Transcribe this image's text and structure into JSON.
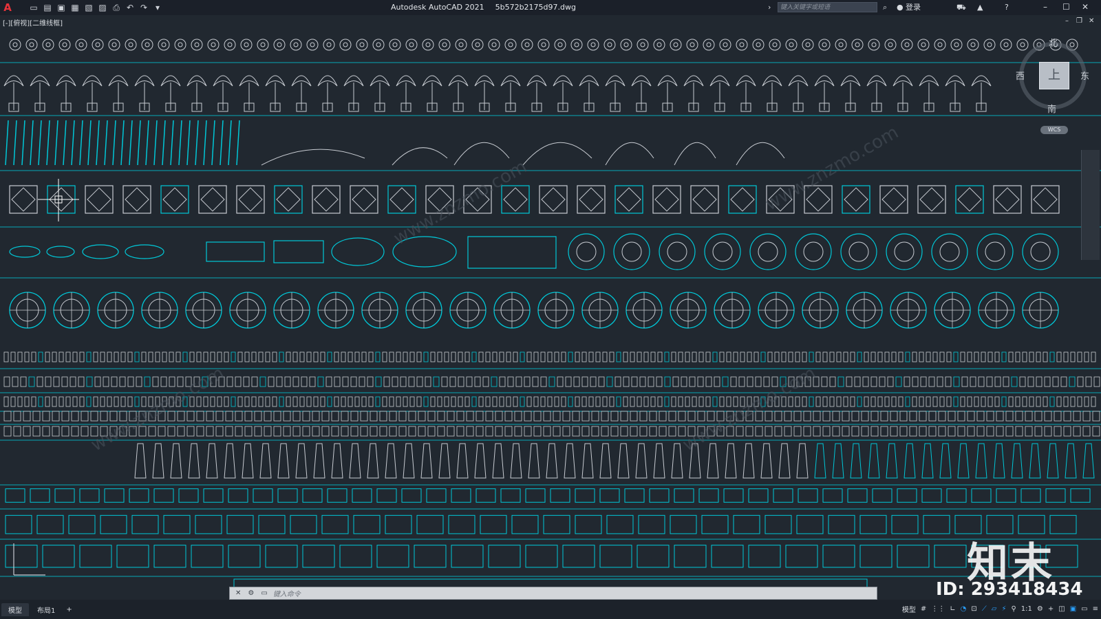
{
  "app": {
    "title": "Autodesk AutoCAD 2021",
    "filename": "5b572b2175d97.dwg",
    "logo_letter": "A",
    "accent": "#00c8d8",
    "line_color": "#c8ccd2"
  },
  "quick_access": [
    "new-icon",
    "open-icon",
    "save-icon",
    "saveas-icon",
    "publish-icon",
    "plot-preview-icon",
    "print-icon",
    "undo-icon",
    "redo-icon",
    "customize-icon"
  ],
  "search": {
    "placeholder": "键入关键字或短语"
  },
  "account": {
    "login_label": "登录"
  },
  "viewport": {
    "label": "[-][俯视][二维线框]"
  },
  "viewcube": {
    "top": "上",
    "west": "西",
    "east": "东",
    "south": "南",
    "north": "北",
    "wcs": "WCS"
  },
  "command": {
    "placeholder": "键入命令"
  },
  "tabs": [
    {
      "label": "模型"
    },
    {
      "label": "布局1"
    }
  ],
  "tab_add": "+",
  "status": {
    "model_label": "模型",
    "scale": "1:1"
  },
  "watermark": {
    "brand": "知末",
    "id_text": "ID: 293418434",
    "site": "www.znzmo.com"
  }
}
